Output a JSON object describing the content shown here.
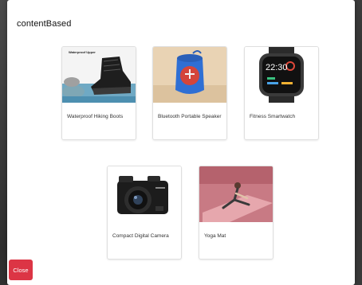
{
  "modal": {
    "title": "contentBased",
    "close_label": "Close"
  },
  "products": [
    {
      "name": "Waterproof Hiking Boots",
      "image_caption": "Waterproof Upper",
      "icon": "hiking-boots-image"
    },
    {
      "name": "Bluetooth Portable Speaker",
      "icon": "speaker-image"
    },
    {
      "name": "Fitness Smartwatch",
      "watch_time": "22:30",
      "icon": "smartwatch-image"
    },
    {
      "name": "Compact Digital Camera",
      "icon": "camera-image"
    },
    {
      "name": "Yoga Mat",
      "icon": "yoga-mat-image"
    }
  ],
  "colors": {
    "close_button": "#dc3545"
  }
}
